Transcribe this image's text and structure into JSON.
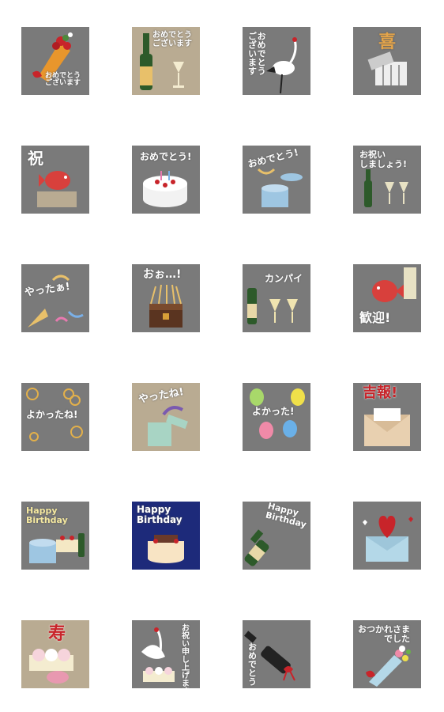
{
  "stickers": [
    {
      "label": "おめでとう\nございます"
    },
    {
      "label": "おめでとう\nございます"
    },
    {
      "label": "おめでとう\nございます"
    },
    {
      "label": "喜"
    },
    {
      "label": "祝"
    },
    {
      "label": "おめでとう!"
    },
    {
      "label": "おめでとう!"
    },
    {
      "label": "お祝い\nしましょう!"
    },
    {
      "label": "やったぁ!"
    },
    {
      "label": "おぉ…!"
    },
    {
      "label": "カンパイ"
    },
    {
      "label": "歓迎!"
    },
    {
      "label": "よかったね!"
    },
    {
      "label": "やったね!"
    },
    {
      "label": "よかった!"
    },
    {
      "label": "吉報!"
    },
    {
      "label": "Happy Birthday"
    },
    {
      "label": "Happy Birthday"
    },
    {
      "label": "Happy Birthday"
    },
    {
      "label": ""
    },
    {
      "label": "寿"
    },
    {
      "label": "お祝い申し上げます"
    },
    {
      "label": "おめでとう"
    },
    {
      "label": "おつかれさま\nでした"
    }
  ],
  "colors": {
    "tile_gray": "#7a7a7a",
    "tile_beige": "#b9ab92",
    "tile_navy": "#1d2a7a",
    "accent_red": "#c8242a"
  }
}
